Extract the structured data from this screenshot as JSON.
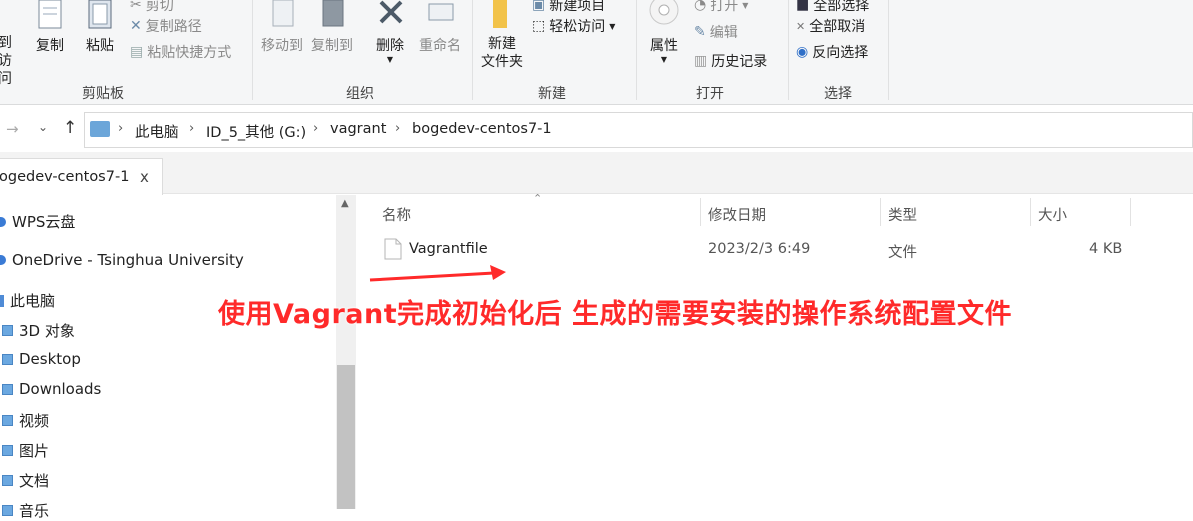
{
  "ribbon": {
    "clipboard": {
      "label": "剪贴板",
      "pin_label_1": "到",
      "pin_label_2": "访问",
      "copy": "复制",
      "paste": "粘贴",
      "cut": "剪切",
      "copy_path": "复制路径",
      "paste_shortcut": "粘贴快捷方式"
    },
    "organize": {
      "label": "组织",
      "move_to": "移动到",
      "copy_to": "复制到",
      "delete": "删除",
      "rename": "重命名"
    },
    "new": {
      "label": "新建",
      "new_folder_1": "新建",
      "new_folder_2": "文件夹",
      "new_item": "新建项目",
      "easy_access": "轻松访问"
    },
    "open": {
      "label": "打开",
      "properties": "属性",
      "open": "打开",
      "edit": "编辑",
      "history": "历史记录"
    },
    "select": {
      "label": "选择",
      "select_all": "全部选择",
      "select_none": "全部取消",
      "invert": "反向选择"
    }
  },
  "address": {
    "crumbs": [
      "此电脑",
      "ID_5_其他 (G:)",
      "vagrant",
      "bogedev-centos7-1"
    ]
  },
  "tab": {
    "title": "ogedev-centos7-1",
    "close": "x"
  },
  "nav": {
    "items": [
      {
        "label": "WPS云盘",
        "icon": "cloud-icon"
      },
      {
        "label": "OneDrive - Tsinghua University",
        "icon": "cloud-icon"
      },
      {
        "label": "此电脑",
        "icon": "pc-icon"
      },
      {
        "label": "3D 对象",
        "icon": "folder-icon"
      },
      {
        "label": "Desktop",
        "icon": "folder-icon"
      },
      {
        "label": "Downloads",
        "icon": "folder-icon"
      },
      {
        "label": "视频",
        "icon": "folder-icon"
      },
      {
        "label": "图片",
        "icon": "folder-icon"
      },
      {
        "label": "文档",
        "icon": "folder-icon"
      },
      {
        "label": "音乐",
        "icon": "folder-icon"
      }
    ]
  },
  "list": {
    "columns": [
      "名称",
      "修改日期",
      "类型",
      "大小"
    ],
    "rows": [
      {
        "name": "Vagrantfile",
        "date": "2023/2/3 6:49",
        "type": "文件",
        "size": "4 KB"
      }
    ]
  },
  "annotation": {
    "text": "使用Vagrant完成初始化后 生成的需要安装的操作系统配置文件",
    "color": "#ff2a2a"
  }
}
